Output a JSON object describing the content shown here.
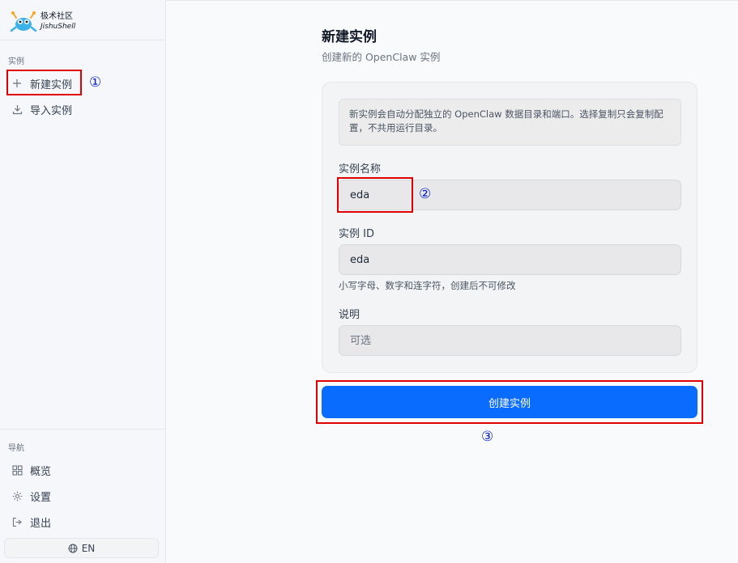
{
  "brand": {
    "name_cn": "极术社区",
    "name_en": "JishuShell",
    "logo_icon": "mascot-logo"
  },
  "sidebar": {
    "section_instances": "实例",
    "items": [
      {
        "label": "新建实例",
        "icon": "plus-icon",
        "active": true
      },
      {
        "label": "导入实例",
        "icon": "download-icon"
      }
    ],
    "section_nav": "导航",
    "nav_items": [
      {
        "label": "概览",
        "icon": "grid-icon"
      },
      {
        "label": "设置",
        "icon": "gear-icon"
      },
      {
        "label": "退出",
        "icon": "logout-icon"
      }
    ],
    "language_button": "EN"
  },
  "main": {
    "title": "新建实例",
    "subtitle": "创建新的 OpenClaw 实例",
    "notice": "新实例会自动分配独立的 OpenClaw 数据目录和端口。选择复制只会复制配置，不共用运行目录。",
    "fields": {
      "name": {
        "label": "实例名称",
        "value": "eda"
      },
      "id": {
        "label": "实例 ID",
        "value": "eda",
        "hint": "小写字母、数字和连字符，创建后不可修改"
      },
      "description": {
        "label": "说明",
        "placeholder": "可选",
        "value": ""
      }
    },
    "submit_label": "创建实例"
  },
  "annotations": {
    "step1": "①",
    "step2": "②",
    "step3": "③"
  },
  "colors": {
    "primary": "#0a6cff",
    "annotation_box": "#e00000",
    "annotation_number": "#0a24c8"
  }
}
